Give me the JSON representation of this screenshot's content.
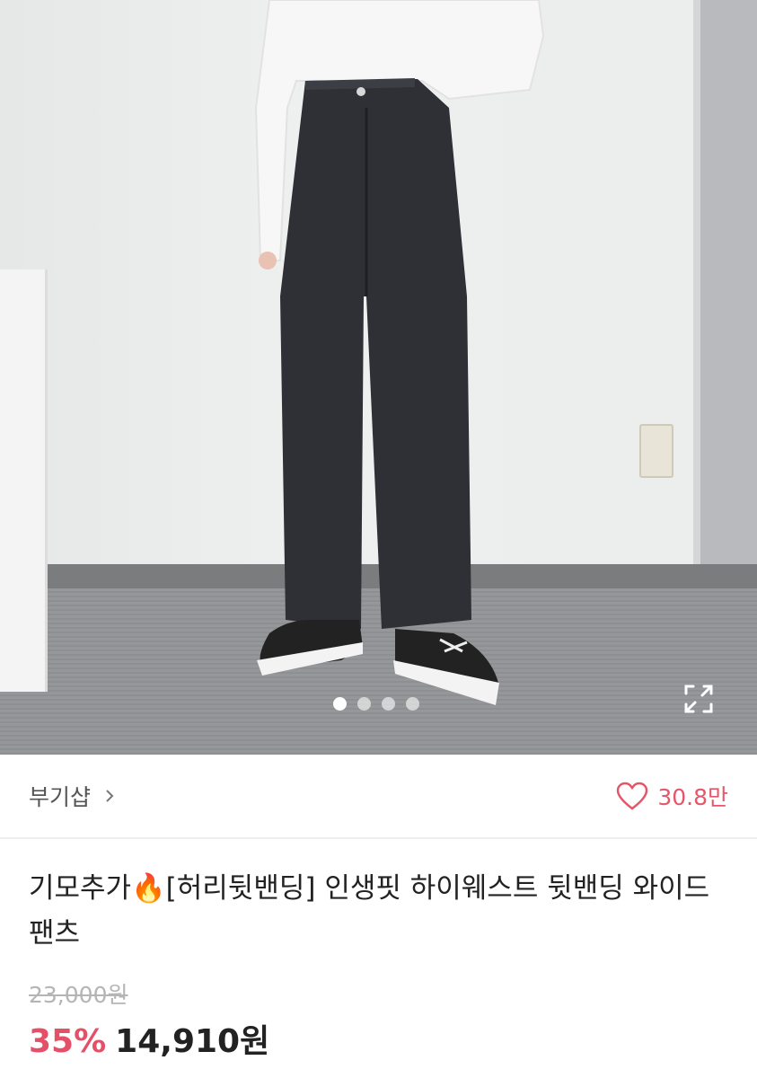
{
  "hero": {
    "slide_count": 4,
    "active_slide": 1,
    "expand_icon": "expand-icon"
  },
  "shop": {
    "name": "부기샵",
    "chevron_icon": "chevron-right-icon"
  },
  "likes": {
    "icon": "heart-outline-icon",
    "count": "30.8만",
    "color": "#e4576a"
  },
  "product": {
    "title": "기모추가🔥[허리뒷밴딩] 인생핏 하이웨스트 뒷밴딩 와이드 팬츠",
    "original_price": "23,000원",
    "discount": "35%",
    "price": "14,910원",
    "discount_color": "#e45068"
  }
}
